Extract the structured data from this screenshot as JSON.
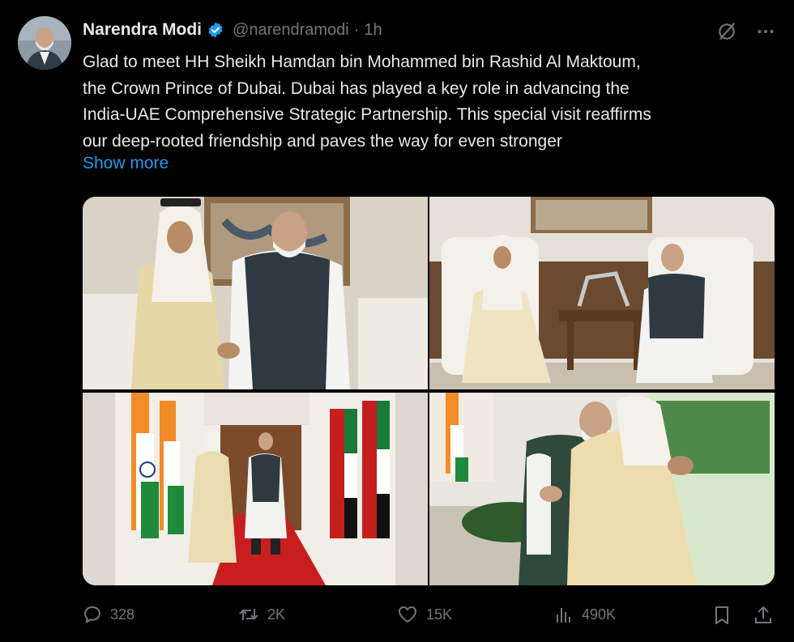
{
  "author": {
    "name": "Narendra Modi",
    "handle": "@narendramodi",
    "separator": "·",
    "time": "1h",
    "avatar_icon": "avatar-photo"
  },
  "post": {
    "text": "Glad to meet HH Sheikh Hamdan bin Mohammed bin Rashid Al Maktoum,\nthe Crown Prince of Dubai. Dubai has played a key role in advancing the\nIndia-UAE Comprehensive Strategic Partnership. This special visit reaffirms\nour deep-rooted friendship and paves the way for even stronger",
    "show_more": "Show more"
  },
  "media": {
    "photos": [
      "handshake-photo",
      "seated-meeting-photo",
      "walking-corridor-photo",
      "embrace-photo"
    ]
  },
  "actions": {
    "replies": "328",
    "reposts": "2K",
    "likes": "15K",
    "views": "490K"
  },
  "colors": {
    "background": "#000000",
    "text": "#e7e9ea",
    "muted": "#71767b",
    "link": "#1d9bf0",
    "verified": "#1d9bf0"
  }
}
